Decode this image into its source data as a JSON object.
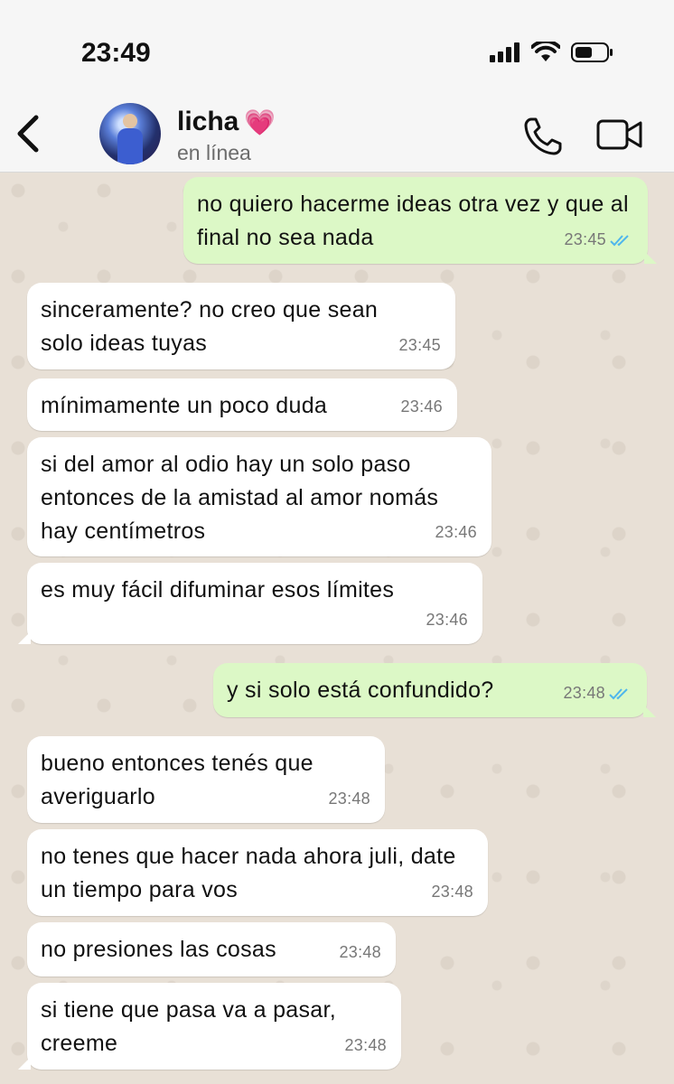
{
  "status_bar": {
    "time": "23:49"
  },
  "header": {
    "contact_name": "licha",
    "contact_emoji": "💗",
    "presence": "en línea"
  },
  "icons": {
    "back": "chevron-left-icon",
    "call": "phone-icon",
    "video": "video-camera-icon",
    "read_receipt": "double-check-icon"
  },
  "colors": {
    "outgoing_bubble": "#dcf8c6",
    "incoming_bubble": "#ffffff",
    "read_ticks": "#4fb6ec",
    "wallpaper": "#e8e0d6"
  },
  "messages": [
    {
      "dir": "out",
      "text": "no quiero hacerme ideas otra vez y que al final no sea nada",
      "time": "23:45",
      "read": true
    },
    {
      "dir": "in",
      "text": "sinceramente? no creo que sean solo ideas tuyas",
      "time": "23:45"
    },
    {
      "dir": "in",
      "text": "mínimamente un poco duda",
      "time": "23:46"
    },
    {
      "dir": "in",
      "text": "si del amor al odio hay un solo paso entonces de la amistad al amor nomás hay centímetros",
      "time": "23:46"
    },
    {
      "dir": "in",
      "text": "es muy fácil difuminar esos límites",
      "time": "23:46"
    },
    {
      "dir": "out",
      "text": "y si solo está confundido?",
      "time": "23:48",
      "read": true
    },
    {
      "dir": "in",
      "text": "bueno entonces tenés que averiguarlo",
      "time": "23:48"
    },
    {
      "dir": "in",
      "text": "no tenes que hacer nada ahora juli, date un tiempo para vos",
      "time": "23:48"
    },
    {
      "dir": "in",
      "text": "no presiones las cosas",
      "time": "23:48"
    },
    {
      "dir": "in",
      "text": "si tiene que pasa va a pasar, creeme",
      "time": "23:48"
    }
  ]
}
